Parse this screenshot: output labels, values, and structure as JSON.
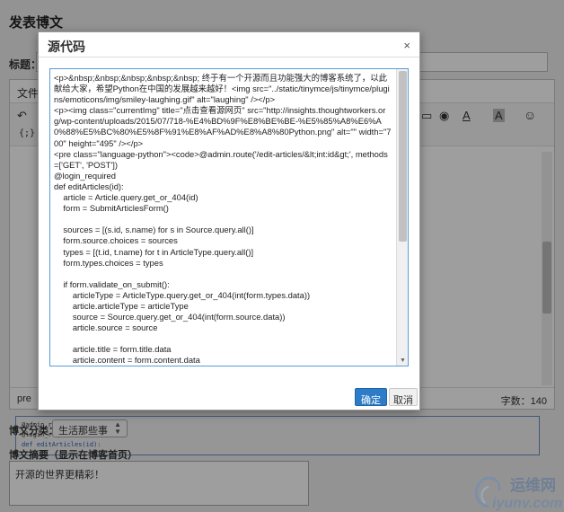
{
  "page": {
    "title": "发表博文",
    "title_label": "标题："
  },
  "editor": {
    "menu_file": "文件",
    "status_left": "pre",
    "status_right": "字数：140"
  },
  "form": {
    "category_label": "博文分类：",
    "category_value": "生活那些事",
    "summary_label": "博文摘要（显示在博客首页）",
    "summary_value": "开源的世界更精彩！"
  },
  "modal": {
    "title": "源代码",
    "close": "×",
    "source": "<p>&nbsp;&nbsp;&nbsp;&nbsp;&nbsp; 终于有一个开源而且功能强大的博客系统了，以此献给大家，希望Python在中国的发展越来越好！<img src=\"../static/tinymce/js/tinymce/plugins/emoticons/img/smiley-laughing.gif\" alt=\"laughing\" /></p>\n<p><img class=\"currentImg\" title=\"点击查看源网页\" src=\"http://insights.thoughtworkers.org/wp-content/uploads/2015/07/718-%E4%BD%9F%E8%BE%BE-%E5%85%A8%E6%A0%88%E5%BC%80%E5%8F%91%E8%AF%AD%E8%A8%80Python.png\" alt=\"\" width=\"700\" height=\"495\" /></p>\n<pre class=\"language-python\"><code>@admin.route('/edit-articles/&lt;int:id&gt;', methods=['GET', 'POST'])\n@login_required\ndef editArticles(id):\n    article = Article.query.get_or_404(id)\n    form = SubmitArticlesForm()\n\n    sources = [(s.id, s.name) for s in Source.query.all()]\n    form.source.choices = sources\n    types = [(t.id, t.name) for t in ArticleType.query.all()]\n    form.types.choices = types\n\n    if form.validate_on_submit():\n        articleType = ArticleType.query.get_or_404(int(form.types.data))\n        article.articleType = articleType\n        source = Source.query.get_or_404(int(form.source.data))\n        article.source = source\n\n        article.title = form.title.data\n        article.content = form.content.data",
    "ok": "确定",
    "cancel": "取消"
  },
  "watermark": {
    "cn": "运维网",
    "url": "iyunv.com"
  }
}
